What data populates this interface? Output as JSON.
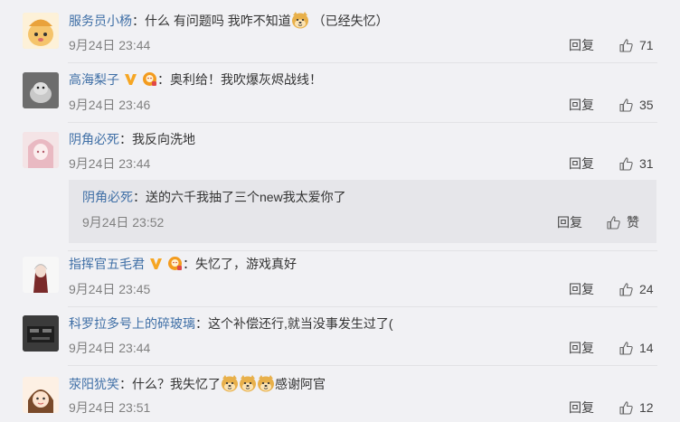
{
  "comments": [
    {
      "user": "服务员小杨",
      "text": "什么 有问题吗 我咋不知道",
      "text_after": "（已经失忆）",
      "time": "9月24日 23:44",
      "reply_label": "回复",
      "likes": "71"
    },
    {
      "user": "高海梨子",
      "text": "奥利给！我吹爆灰烬战线！",
      "time": "9月24日 23:46",
      "reply_label": "回复",
      "likes": "35"
    },
    {
      "user": "阴角必死",
      "text": "我反向洗地",
      "time": "9月24日 23:44",
      "reply_label": "回复",
      "likes": "31",
      "sub_reply": {
        "user": "阴角必死",
        "text": "送的六千我抽了三个new我太爱你了",
        "time": "9月24日 23:52",
        "reply_label": "回复",
        "like_label": "赞"
      }
    },
    {
      "user": "指挥官五毛君",
      "text": "失忆了，游戏真好",
      "time": "9月24日 23:45",
      "reply_label": "回复",
      "likes": "24"
    },
    {
      "user": "科罗拉多号上的碎玻璃",
      "text": "这个补偿还行,就当没事发生过了(",
      "time": "9月24日 23:44",
      "reply_label": "回复",
      "likes": "14"
    },
    {
      "user": "荥阳犹笑",
      "text": "什么？我失忆了",
      "text_after": "感谢阿官",
      "time": "9月24日 23:51",
      "reply_label": "回复",
      "likes": "12"
    }
  ],
  "colors": {
    "username": "#3f6fa6",
    "background": "#f1f1f4",
    "subpanel": "#e6e6ea",
    "meta": "#808080"
  },
  "icons": [
    "doge-emoji-icon",
    "vip-v-icon",
    "member-badge-icon",
    "thumbs-up-icon"
  ]
}
